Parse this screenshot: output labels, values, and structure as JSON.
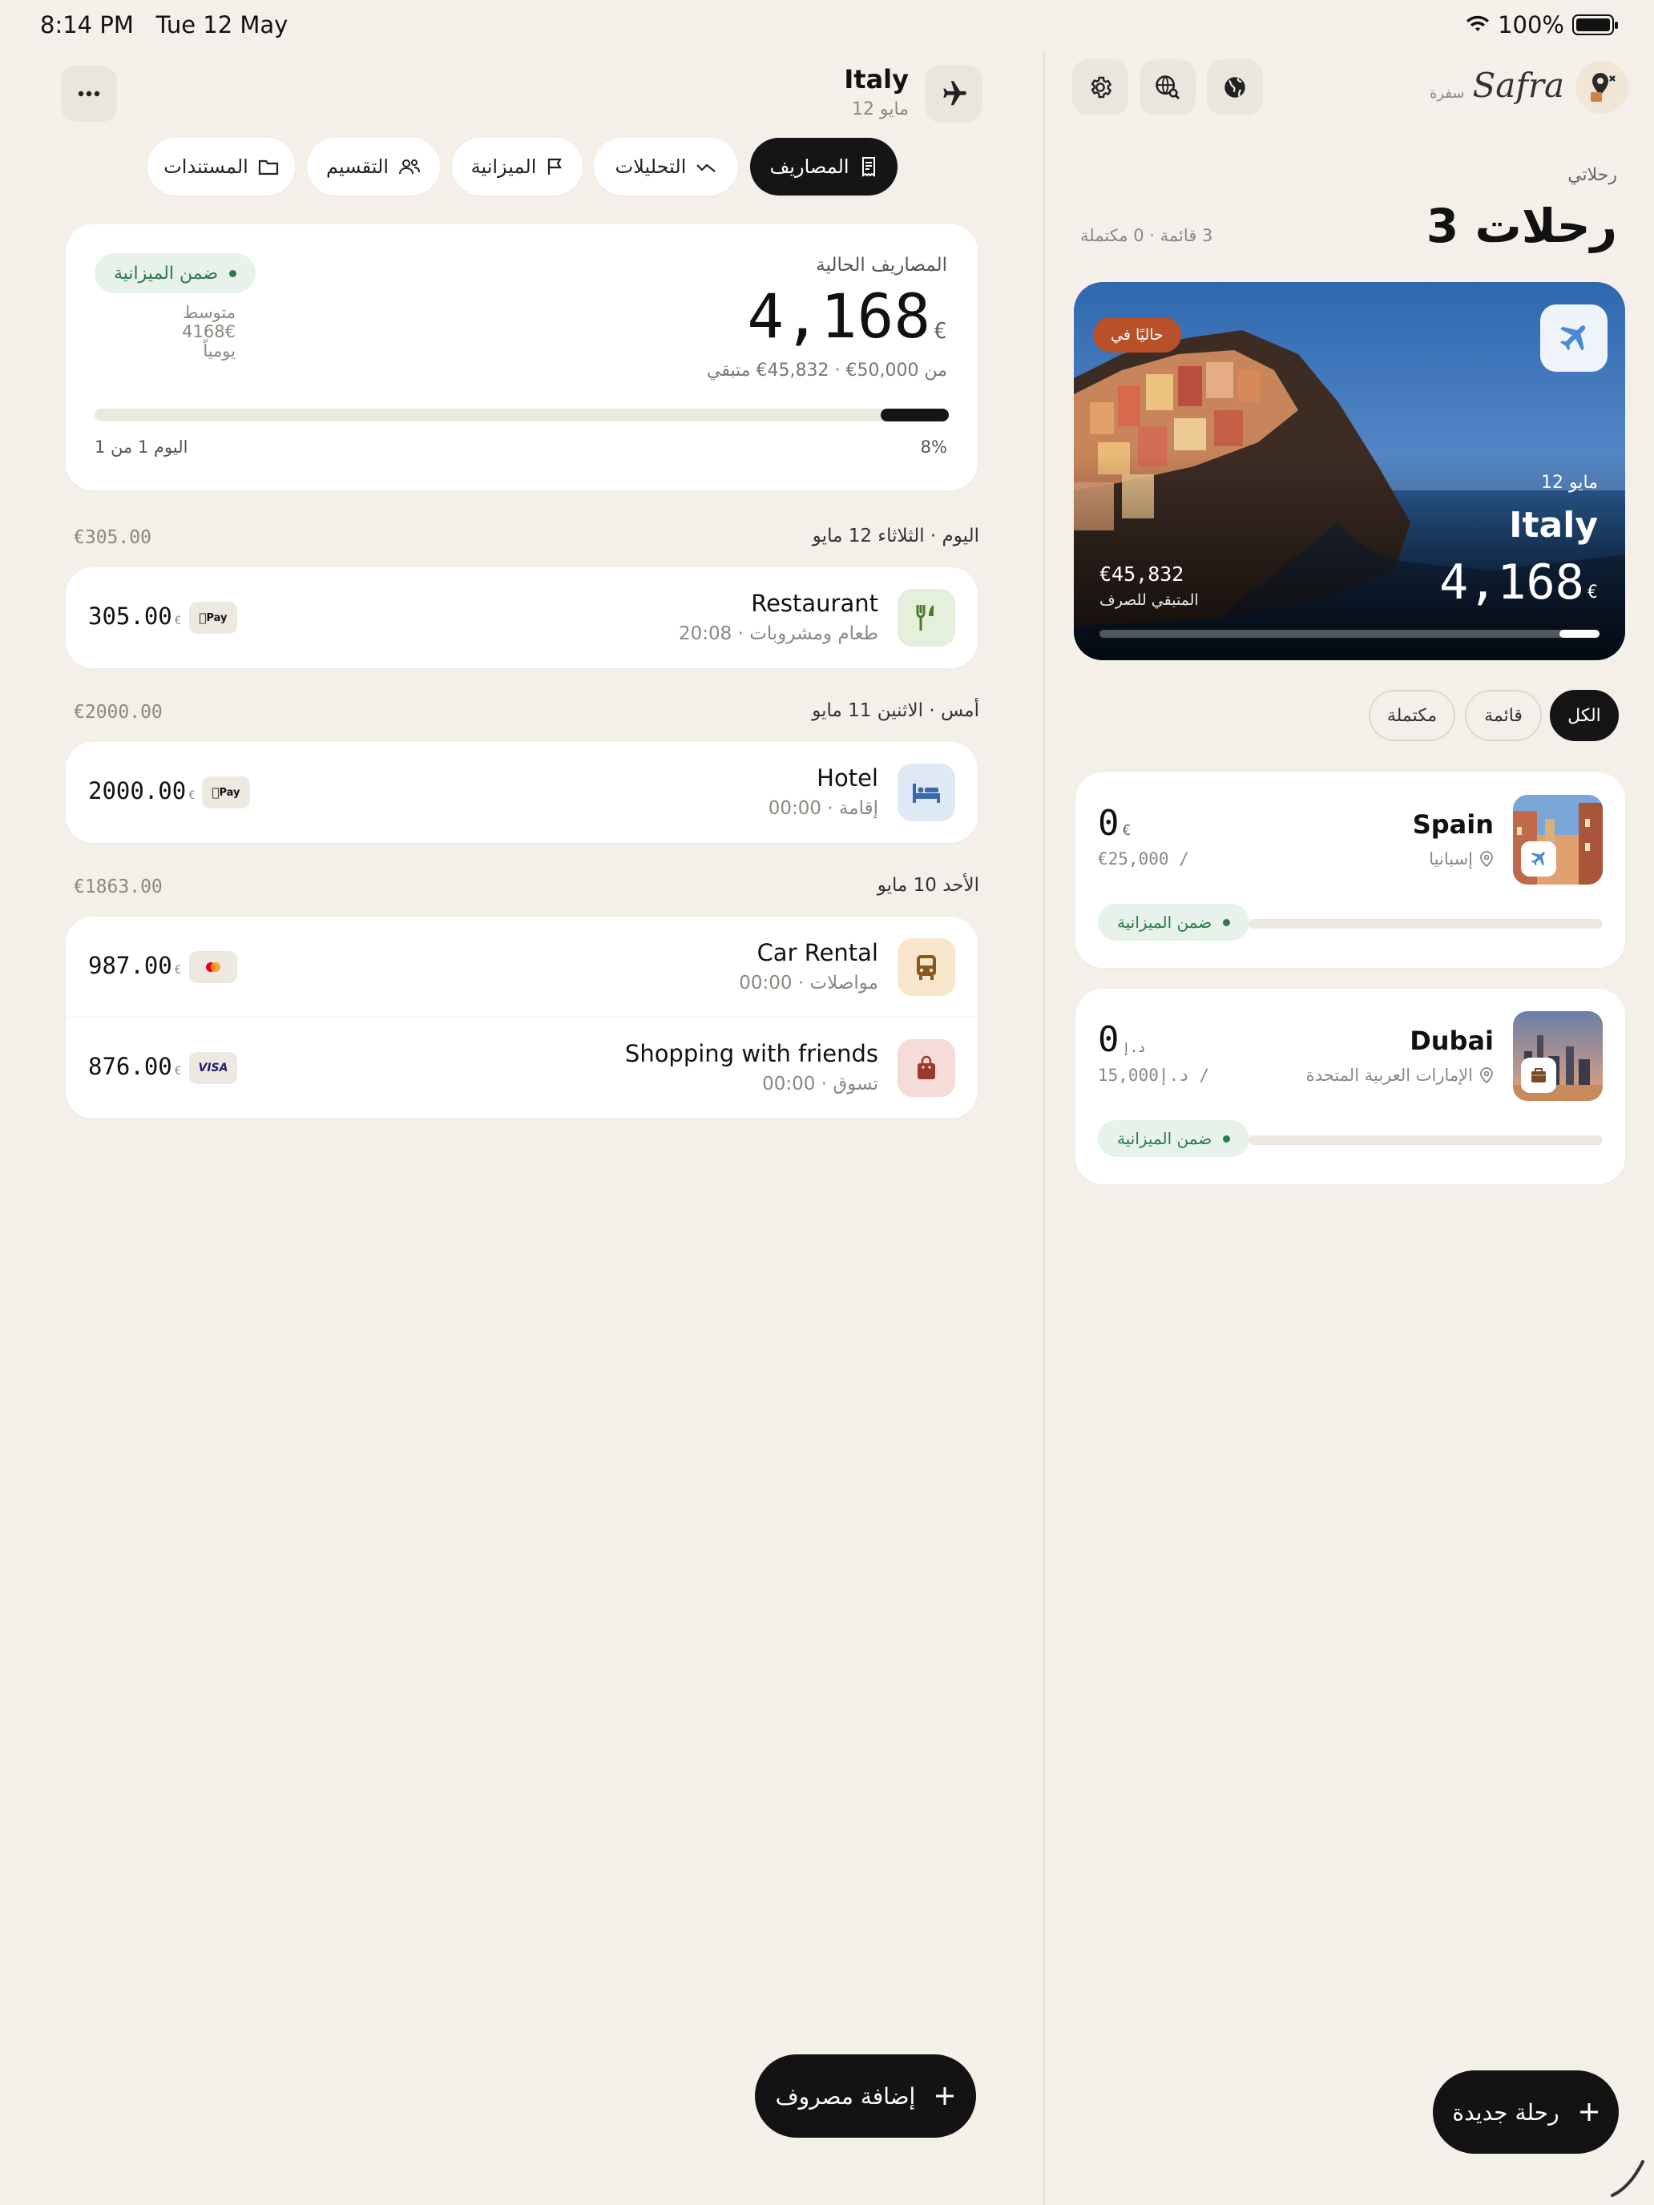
{
  "status_bar": {
    "time": "8:14 PM",
    "date": "Tue 12 May",
    "battery": "100%"
  },
  "trip_header": {
    "title": "Italy",
    "date": "12 مايو"
  },
  "tabs": [
    {
      "label": "المصاريف",
      "active": true
    },
    {
      "label": "التحليلات"
    },
    {
      "label": "الميزانية"
    },
    {
      "label": "التقسيم"
    },
    {
      "label": "المستندات"
    }
  ],
  "summary": {
    "label": "المصاريف الحالية",
    "amount": "4,168",
    "currency": "€",
    "budget_line": "من 50,000€ · 45,832€ متبقي",
    "badge": "ضمن الميزانية",
    "avg_line1": "متوسط 4168€",
    "avg_line2": "يومياً",
    "day_progress": "اليوم 1 من 1",
    "percent": "8%",
    "progress_fraction": 0.08
  },
  "expense_groups": [
    {
      "header": "اليوم · الثلاثاء 12 مايو",
      "total": "€305.00",
      "items": [
        {
          "title": "Restaurant",
          "subtitle": "طعام ومشروبات · 20:08",
          "amount": "305.00",
          "currency": "€",
          "payment": "Pay",
          "category_icon": "fork-knife-icon",
          "category_color": "#e5f0dc"
        }
      ]
    },
    {
      "header": "أمس · الاثنين 11 مايو",
      "total": "€2000.00",
      "items": [
        {
          "title": "Hotel",
          "subtitle": "إقامة · 00:00",
          "amount": "2000.00",
          "currency": "€",
          "payment": "Pay",
          "category_icon": "bed-icon",
          "category_color": "#dfe9f5"
        }
      ]
    },
    {
      "header": "الأحد 10 مايو",
      "total": "€1863.00",
      "items": [
        {
          "title": "Car Rental",
          "subtitle": "مواصلات · 00:00",
          "amount": "987.00",
          "currency": "€",
          "payment": "mastercard",
          "category_icon": "bus-icon",
          "category_color": "#f7e6cc"
        },
        {
          "title": "Shopping with friends",
          "subtitle": "تسوق · 00:00",
          "amount": "876.00",
          "currency": "€",
          "payment": "VISA",
          "category_icon": "shopping-bag-icon",
          "category_color": "#f6dcd8"
        }
      ]
    }
  ],
  "add_expense_label": "إضافة مصروف",
  "app": {
    "name": "Safra",
    "name_ar": "سفرة"
  },
  "trips_section": {
    "label": "رحلاتي",
    "title": "3 رحلات",
    "stats": "3 قائمة · 0 مكتملة"
  },
  "featured_trip": {
    "badge": "حاليًا في",
    "date": "12 مايو",
    "name": "Italy",
    "amount": "4,168",
    "currency": "€",
    "remaining": "€45,832",
    "remaining_label": "المتبقي للصرف",
    "progress_fraction": 0.08
  },
  "filters": [
    {
      "label": "الكل",
      "active": true
    },
    {
      "label": "قائمة"
    },
    {
      "label": "مكتملة"
    }
  ],
  "trips": [
    {
      "name": "Spain",
      "location": "إسبانيا",
      "amount": "0",
      "currency": "€",
      "budget": "/ €25,000",
      "badge": "ضمن الميزانية",
      "progress_fraction": 0
    },
    {
      "name": "Dubai",
      "location": "الإمارات العربية المتحدة",
      "amount": "0",
      "currency": "د.إ",
      "budget": "/ د.إ15,000",
      "badge": "ضمن الميزانية",
      "progress_fraction": 0
    }
  ],
  "new_trip_label": "رحلة جديدة",
  "colors": {
    "background": "#f4f0e9",
    "dark": "#151515",
    "green": "#2d7a48",
    "badge_orange": "#b8502a"
  }
}
